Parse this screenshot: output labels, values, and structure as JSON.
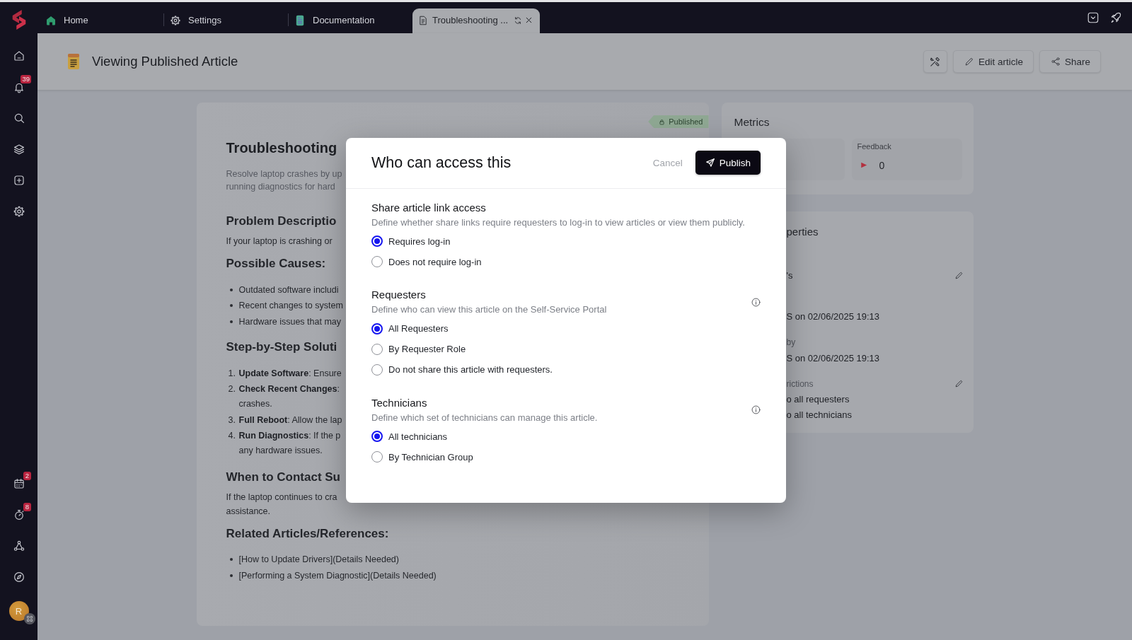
{
  "top_bar": {
    "tabs": [
      {
        "label": "Home",
        "selected": false
      },
      {
        "label": "Settings",
        "selected": false
      },
      {
        "label": "Documentation",
        "selected": false
      },
      {
        "label": "Troubleshooting ...",
        "selected": true
      }
    ]
  },
  "sidebar": {
    "items": [
      {
        "selected": false
      },
      {
        "selected": false,
        "badge": "39"
      },
      {
        "selected": false
      },
      {
        "selected": false
      },
      {
        "selected": false
      },
      {
        "selected": false
      }
    ],
    "bottom_items": [
      {
        "selected": false,
        "badge": "2"
      },
      {
        "selected": false,
        "badge": "8"
      },
      {
        "selected": false
      },
      {
        "selected": false
      }
    ],
    "avatar": {
      "initial": "R"
    }
  },
  "header": {
    "title": "Viewing Published Article",
    "actions": [
      {
        "kind": "icon"
      },
      {
        "kind": "text",
        "label": "Edit article"
      },
      {
        "kind": "text",
        "label": "Share"
      }
    ]
  },
  "article": {
    "status": "Published",
    "title": "Troubleshooting",
    "description": [
      "Resolve laptop crashes by up",
      "running diagnostics for hard"
    ],
    "sections": [
      {
        "heading": "Problem Descriptio",
        "kind": "paragraph",
        "lines": [
          "If your laptop is crashing or"
        ]
      },
      {
        "heading": "Possible Causes:",
        "kind": "bullets",
        "items": [
          "Outdated software includi",
          "Recent changes to system",
          "Hardware issues that may"
        ]
      },
      {
        "heading": "Step-by-Step Soluti",
        "kind": "numbered",
        "items": [
          {
            "number": "1.",
            "lines": [
              "**Update Software**: Ensure"
            ]
          },
          {
            "number": "2.",
            "lines": [
              "**Check Recent Changes**:",
              "crashes."
            ]
          },
          {
            "number": "3.",
            "lines": [
              "**Full Reboot**: Allow the lap"
            ]
          },
          {
            "number": "4.",
            "lines": [
              "**Run Diagnostics**: If the p",
              "any hardware issues."
            ]
          }
        ]
      },
      {
        "heading": "When to Contact Su",
        "kind": "paragraph",
        "lines": [
          "If the laptop continues to cra",
          "assistance."
        ]
      },
      {
        "heading": "Related Articles/References:",
        "kind": "bullets",
        "items": [
          "[How to Update Drivers](Details Needed)",
          "[Performing a System Diagnostic](Details Needed)"
        ]
      }
    ]
  },
  "metrics": {
    "title": "Metrics",
    "cards": [
      {
        "kind": "empty"
      },
      {
        "kind": "feedback",
        "label": "Feedback",
        "value": "0"
      }
    ]
  },
  "properties": {
    "title": "perties",
    "fields": [
      {
        "lines": [
          "'s"
        ],
        "editable": true
      },
      {
        "lines": [
          "S on 02/06/2025 19:13"
        ],
        "editable": false
      },
      {
        "label": "by",
        "lines": [
          "S on 02/06/2025 19:13"
        ],
        "editable": false
      },
      {
        "label": "rictions",
        "lines": [
          "o all requesters",
          "o all technicians"
        ],
        "editable": true
      }
    ]
  },
  "dialog": {
    "title": "Who can access this",
    "cancel": "Cancel",
    "confirm": "Publish",
    "sections": [
      {
        "title": "Share article link access",
        "description": "Define whether share links require requesters to log-in to view articles or view them publicly.",
        "info": false,
        "options": [
          {
            "label": "Requires log-in",
            "selected": true
          },
          {
            "label": "Does not require log-in",
            "selected": false
          }
        ]
      },
      {
        "title": "Requesters",
        "description": "Define who can view this article on the Self-Service Portal",
        "info": true,
        "options": [
          {
            "label": "All Requesters",
            "selected": true
          },
          {
            "label": "By Requester Role",
            "selected": false
          },
          {
            "label": "Do not share this article with requesters.",
            "selected": false
          }
        ]
      },
      {
        "title": "Technicians",
        "description": "Define which set of technicians can manage this article.",
        "info": true,
        "options": [
          {
            "label": "All technicians",
            "selected": true
          },
          {
            "label": "By Technician Group",
            "selected": false
          }
        ]
      }
    ]
  }
}
